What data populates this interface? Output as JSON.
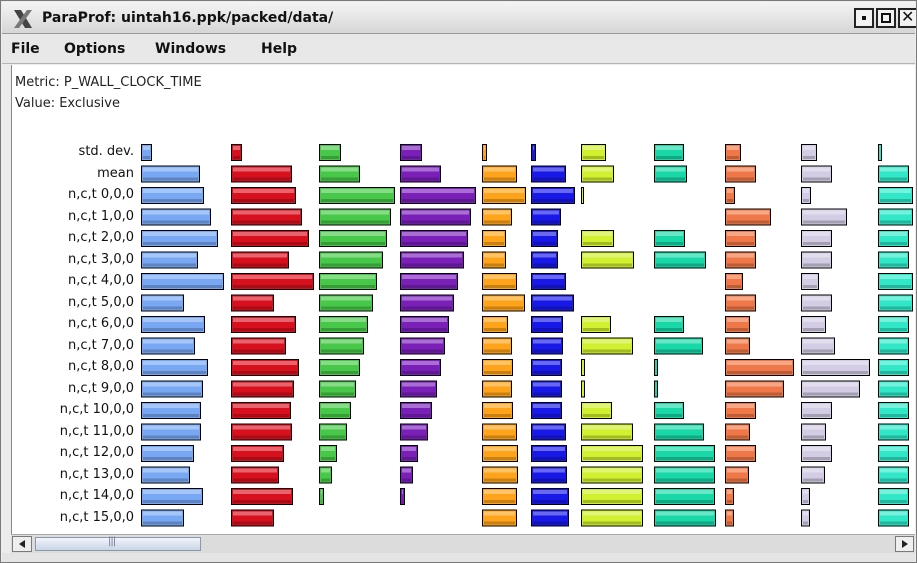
{
  "window": {
    "title": "ParaProf: uintah16.ppk/packed/data/"
  },
  "menu": [
    "File",
    "Options",
    "Windows",
    "Help"
  ],
  "info": {
    "metric": "Metric: P_WALL_CLOCK_TIME",
    "value": "Value: Exclusive"
  },
  "rows": [
    "std. dev.",
    "mean",
    "n,c,t 0,0,0",
    "n,c,t 1,0,0",
    "n,c,t 2,0,0",
    "n,c,t 3,0,0",
    "n,c,t 4,0,0",
    "n,c,t 5,0,0",
    "n,c,t 6,0,0",
    "n,c,t 7,0,0",
    "n,c,t 8,0,0",
    "n,c,t 9,0,0",
    "n,c,t 10,0,0",
    "n,c,t 11,0,0",
    "n,c,t 12,0,0",
    "n,c,t 13,0,0",
    "n,c,t 14,0,0",
    "n,c,t 15,0,0"
  ],
  "columns": [
    {
      "color": "#78a8f4",
      "values": [
        10,
        58,
        62,
        69,
        76,
        56,
        82,
        42,
        63,
        53,
        66,
        61,
        59,
        59,
        52,
        48,
        61,
        42
      ]
    },
    {
      "color": "#d8101e",
      "values": [
        10,
        60,
        64,
        70,
        77,
        57,
        82,
        42,
        64,
        54,
        67,
        62,
        59,
        60,
        52,
        47,
        61,
        42
      ]
    },
    {
      "color": "#48c848",
      "values": [
        21,
        40,
        75,
        71,
        67,
        63,
        57,
        53,
        48,
        44,
        40,
        36,
        31,
        27,
        17,
        12,
        4,
        0
      ]
    },
    {
      "color": "#7a20b8",
      "values": [
        21,
        40,
        75,
        70,
        67,
        63,
        57,
        53,
        48,
        44,
        40,
        36,
        31,
        27,
        17,
        12,
        4,
        0
      ]
    },
    {
      "color": "#ffa41a",
      "values": [
        4,
        34,
        43,
        29,
        23,
        23,
        34,
        42,
        25,
        29,
        30,
        29,
        30,
        34,
        35,
        35,
        34,
        34
      ]
    },
    {
      "color": "#1818e8",
      "values": [
        4,
        34,
        43,
        29,
        26,
        26,
        34,
        42,
        31,
        31,
        30,
        30,
        30,
        34,
        35,
        35,
        37,
        37
      ]
    },
    {
      "color": "#d0f030",
      "values": [
        24,
        32,
        2,
        0,
        32,
        52,
        0,
        0,
        29,
        51,
        3,
        3,
        30,
        51,
        61,
        61,
        61,
        61
      ]
    },
    {
      "color": "#18d8a8",
      "values": [
        29,
        32,
        0,
        0,
        30,
        51,
        0,
        0,
        29,
        48,
        3,
        3,
        29,
        49,
        60,
        60,
        60,
        61
      ]
    },
    {
      "color": "#f07848",
      "values": [
        15,
        30,
        9,
        45,
        30,
        30,
        17,
        30,
        24,
        24,
        68,
        58,
        30,
        24,
        30,
        23,
        8,
        8
      ]
    },
    {
      "color": "#d4cce4",
      "values": [
        15,
        30,
        9,
        45,
        30,
        30,
        17,
        30,
        24,
        33,
        68,
        58,
        30,
        24,
        30,
        23,
        8,
        8
      ]
    },
    {
      "color": "#30e8c8",
      "values": [
        3,
        30,
        34,
        34,
        30,
        30,
        34,
        34,
        30,
        30,
        30,
        30,
        30,
        30,
        30,
        30,
        30,
        30
      ]
    }
  ]
}
